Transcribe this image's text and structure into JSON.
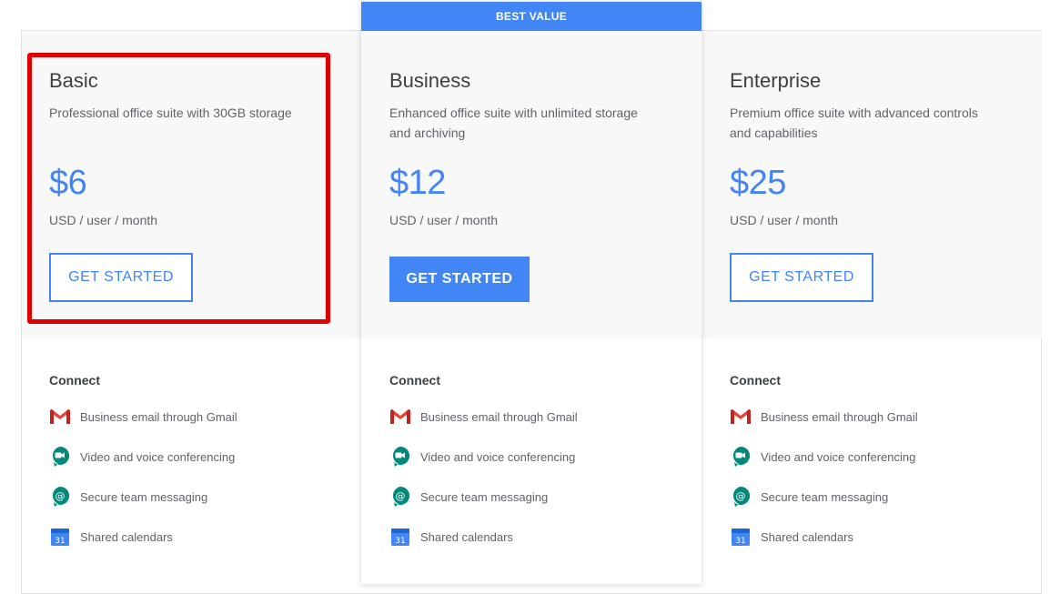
{
  "featured_badge": "BEST VALUE",
  "section_label": "Connect",
  "plans": [
    {
      "name": "Basic",
      "description": "Professional office suite with 30GB storage",
      "price": "$6",
      "unit": "USD / user / month",
      "cta": "GET STARTED",
      "cta_style": "outline"
    },
    {
      "name": "Business",
      "description": "Enhanced office suite with unlimited storage and archiving",
      "price": "$12",
      "unit": "USD / user / month",
      "cta": "GET STARTED",
      "cta_style": "filled"
    },
    {
      "name": "Enterprise",
      "description": "Premium office suite with advanced controls and capabilities",
      "price": "$25",
      "unit": "USD / user / month",
      "cta": "GET STARTED",
      "cta_style": "outline"
    }
  ],
  "features": [
    {
      "icon": "gmail-icon",
      "label": "Business email through Gmail"
    },
    {
      "icon": "meet-icon",
      "label": "Video and voice conferencing"
    },
    {
      "icon": "chat-icon",
      "label": "Secure team messaging"
    },
    {
      "icon": "calendar-icon",
      "label": "Shared calendars"
    }
  ],
  "calendar_day": "31",
  "colors": {
    "accent": "#4285f4",
    "highlight": "#e00000",
    "gmail_red": "#ea4335",
    "meet_green": "#00897b"
  }
}
